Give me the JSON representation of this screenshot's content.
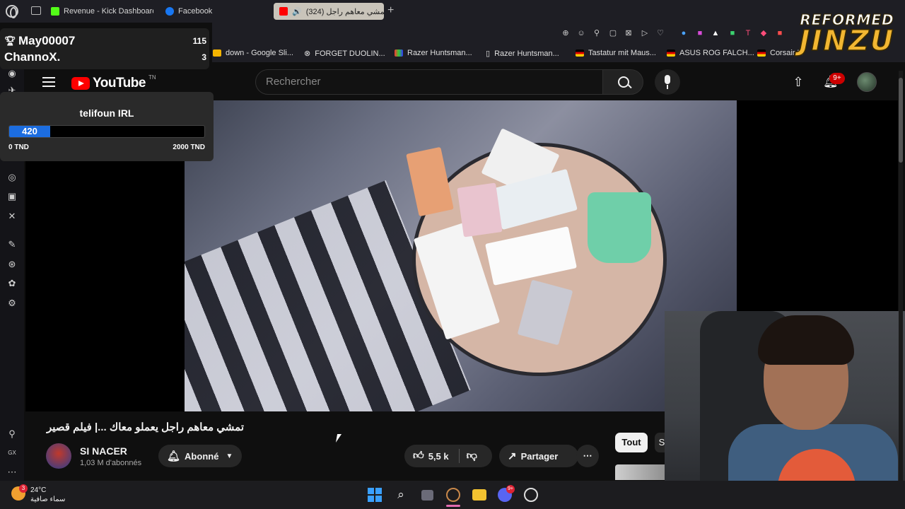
{
  "browser": {
    "tabs": [
      {
        "title": "Revenue - Kick Dashboard",
        "icon": "kick-icon",
        "color": "#53fc18"
      },
      {
        "title": "Facebook",
        "icon": "facebook-icon",
        "color": "#1877f2"
      },
      {
        "title": "(324) تمشي معاهم راجل",
        "icon": "youtube-icon",
        "color": "#ff0000",
        "active": true
      }
    ],
    "new_tab": "+",
    "bookmarks": [
      {
        "title": "down - Google Sli...",
        "icon": "google-slides-icon"
      },
      {
        "title": "FORGET DUOLIN...",
        "icon": "link-icon"
      },
      {
        "title": "Razer Huntsman...",
        "icon": "razer-icon"
      },
      {
        "title": "Razer Huntsman...",
        "icon": "page-icon"
      },
      {
        "title": "Tastatur mit Maus...",
        "icon": "flag-icon"
      },
      {
        "title": "ASUS ROG FALCH...",
        "icon": "flag-icon"
      },
      {
        "title": "Corsair K",
        "icon": "flag-icon"
      }
    ]
  },
  "overlay": {
    "leaderboard": [
      {
        "name": "May00007",
        "count": "115"
      },
      {
        "name": "ChannoX.",
        "count": "3"
      }
    ],
    "goal": {
      "title": "telifoun IRL",
      "current": "420",
      "min_label": "0 TND",
      "max_label": "2000 TND",
      "progress_fraction": 0.21,
      "fill_color": "#1c6de0"
    },
    "streamer_logo": {
      "line1": "REFORMED",
      "line2": "JINZU"
    }
  },
  "youtube": {
    "logo_text": "YouTube",
    "country_code": "TN",
    "search_placeholder": "Rechercher",
    "notification_count": "9+",
    "video": {
      "title": "تمشي معاهم راجل يعملو معاك ...| فيلم قصير",
      "channel_name": "SI NACER",
      "subscribers": "1,03 M d'abonnés",
      "subscribe_label": "Abonné",
      "likes": "5,5 k",
      "share_label": "Partager",
      "more": "⋯"
    },
    "chips": {
      "all": "Tout",
      "next": "S"
    }
  },
  "taskbar": {
    "temperature": "24°C",
    "weather_desc": "سماء صافية",
    "weather_badge": "3",
    "discord_badge": "9+"
  },
  "colors": {
    "youtube_red": "#ff0000",
    "background": "#0f0f0f",
    "goal_blue": "#1c6de0"
  }
}
